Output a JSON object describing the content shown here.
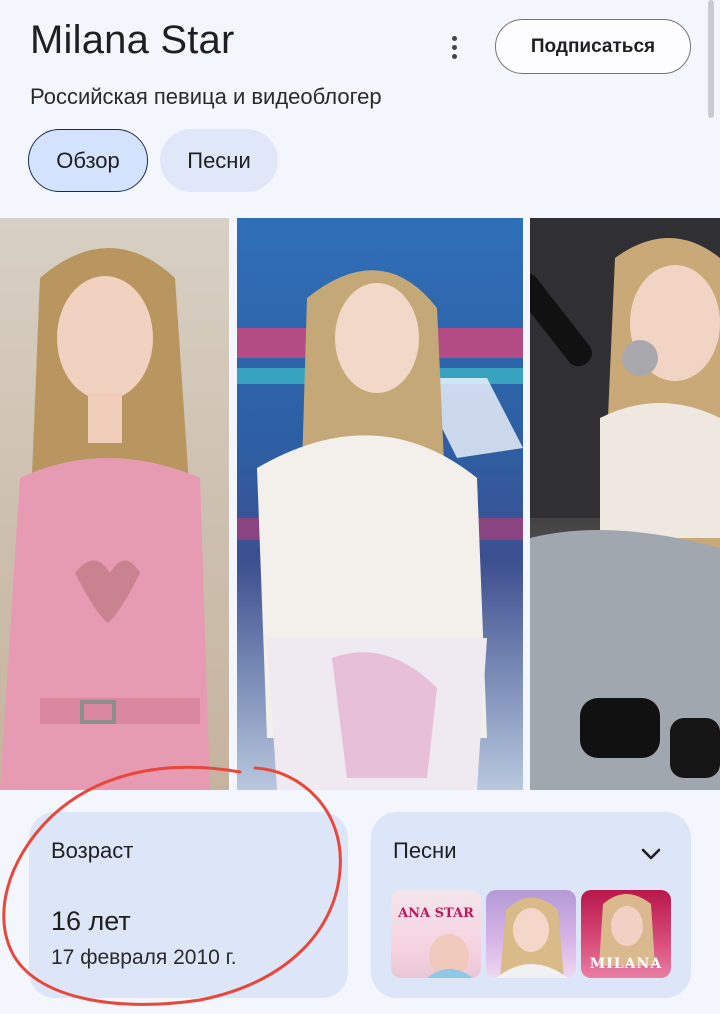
{
  "header": {
    "title": "Milana Star",
    "subtitle": "Российская певица и видеоблогер",
    "subscribe_label": "Подписаться"
  },
  "tabs": [
    {
      "label": "Обзор",
      "selected": true
    },
    {
      "label": "Песни",
      "selected": false
    }
  ],
  "photos": [
    {
      "icon": "person-photo-pink-outfit"
    },
    {
      "icon": "person-photo-white-outfit"
    },
    {
      "icon": "person-photo-microphone"
    }
  ],
  "age_card": {
    "label": "Возраст",
    "value": "16 лет",
    "birth_date": "17 февраля 2010 г."
  },
  "songs_card": {
    "label": "Песни",
    "thumbnails": [
      {
        "text": "ANA STAR"
      },
      {
        "text": ""
      },
      {
        "text": "MILANA"
      }
    ]
  },
  "colors": {
    "background": "#f4f6fd",
    "tab_selected": "#d3e3fd",
    "card": "#dde5f8",
    "annotation": "#e8473a"
  }
}
